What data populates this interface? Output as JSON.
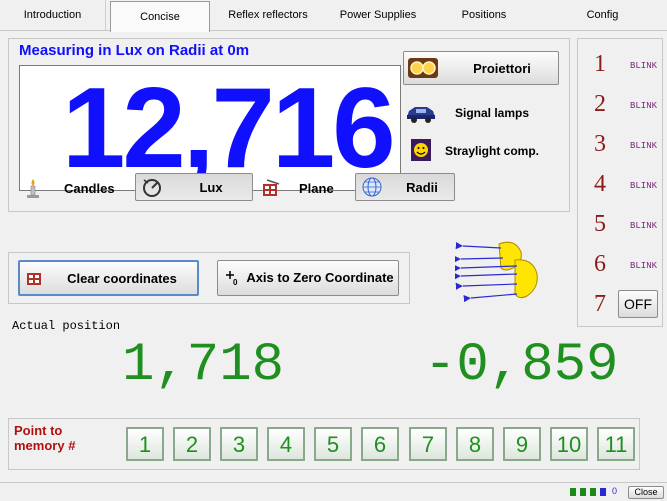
{
  "tabs": [
    {
      "label": "Introduction"
    },
    {
      "label": "Concise"
    },
    {
      "label": "Reflex reflectors"
    },
    {
      "label": "Power Supplies"
    },
    {
      "label": "Positions"
    },
    {
      "label": "Config"
    }
  ],
  "measure": {
    "title": "Measuring in Lux on Radii at 0m",
    "value": "12,716",
    "value_color": "#1010ff"
  },
  "lamps": {
    "proiettori": "Proiettori",
    "signal": "Signal lamps",
    "straylight": "Straylight comp."
  },
  "units": {
    "candles": "Candles",
    "lux": "Lux",
    "plane": "Plane",
    "radii": "Radii"
  },
  "actions": {
    "clear": "Clear coordinates",
    "axis_zero": "Axis to Zero Coordinate"
  },
  "position": {
    "label": "Actual position",
    "x": "1,718",
    "y": "-0,859",
    "color": "#1f8f1f"
  },
  "channels": [
    {
      "num": "1",
      "state": "BLINK"
    },
    {
      "num": "2",
      "state": "BLINK"
    },
    {
      "num": "3",
      "state": "BLINK"
    },
    {
      "num": "4",
      "state": "BLINK"
    },
    {
      "num": "5",
      "state": "BLINK"
    },
    {
      "num": "6",
      "state": "BLINK"
    },
    {
      "num": "7",
      "state": "OFF"
    }
  ],
  "memory": {
    "label_line1": "Point to",
    "label_line2": "memory #",
    "buttons": [
      "1",
      "2",
      "3",
      "4",
      "5",
      "6",
      "7",
      "8",
      "9",
      "10",
      "11"
    ]
  },
  "status": {
    "count": "0",
    "close": "Close"
  }
}
